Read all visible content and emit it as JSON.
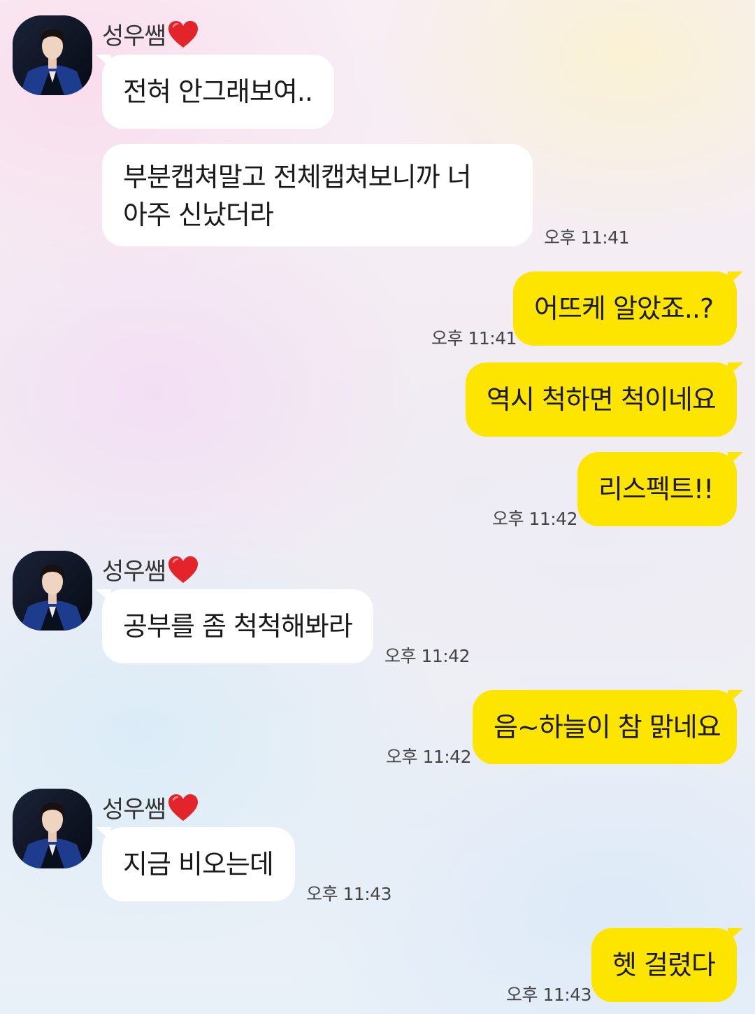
{
  "sender": {
    "name": "성우쌤",
    "avatar_icon": "profile-photo",
    "heart_icon": "red-heart-icon",
    "heart_color": "#e3242b"
  },
  "colors": {
    "outgoing_bubble": "#fee500",
    "incoming_bubble": "#ffffff",
    "timestamp_text": "#444444"
  },
  "messages": [
    {
      "from": "sender",
      "text": "전혀 안그래보여.."
    },
    {
      "from": "sender",
      "lines": [
        "부분캡쳐말고 전체캡쳐보니까 너",
        "아주 신났더라"
      ],
      "time": "오후 11:41"
    },
    {
      "from": "me",
      "text": "어뜨케 알았죠..?",
      "time": "오후 11:41"
    },
    {
      "from": "me",
      "text": "역시 척하면 척이네요"
    },
    {
      "from": "me",
      "text": "리스펙트!!",
      "time": "오후 11:42"
    },
    {
      "from": "sender",
      "text": "공부를 좀 척척해봐라",
      "time": "오후 11:42"
    },
    {
      "from": "me",
      "text": "음~하늘이 참 맑네요",
      "time": "오후 11:42"
    },
    {
      "from": "sender",
      "text": "지금 비오는데",
      "time": "오후 11:43"
    },
    {
      "from": "me",
      "text": "헷 걸렸다",
      "time": "오후 11:43"
    }
  ]
}
